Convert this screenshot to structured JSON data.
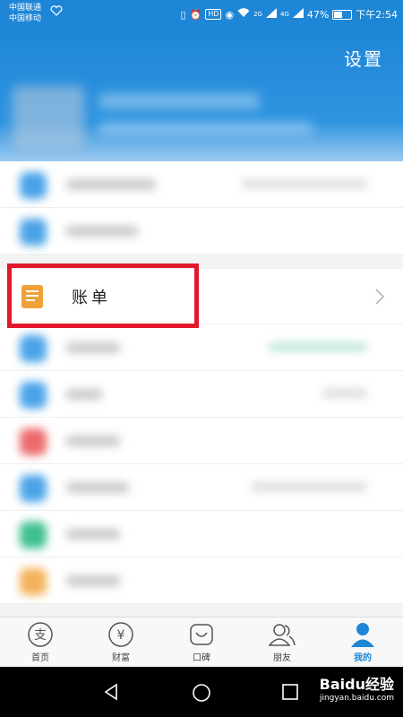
{
  "status_bar": {
    "carrier_1": "中国联通",
    "carrier_2": "中国移动",
    "network_1": "2G",
    "network_2": "4G",
    "battery": "47%",
    "time": "下午2:54"
  },
  "header": {
    "settings_label": "设置"
  },
  "bill_item": {
    "label": "账单",
    "icon": "document-icon",
    "icon_color": "#f0a23a"
  },
  "highlight_color": "#e3192b",
  "accent_color": "#1e86d7",
  "tabbar": {
    "tabs": [
      {
        "label": "首页",
        "icon": "alipay-icon"
      },
      {
        "label": "财富",
        "icon": "yen-icon"
      },
      {
        "label": "口碑",
        "icon": "smile-icon"
      },
      {
        "label": "朋友",
        "icon": "friends-icon"
      },
      {
        "label": "我的",
        "icon": "person-icon",
        "active": true
      }
    ]
  },
  "watermark": {
    "brand": "Baidu经验",
    "url": "jingyan.baidu.com"
  }
}
